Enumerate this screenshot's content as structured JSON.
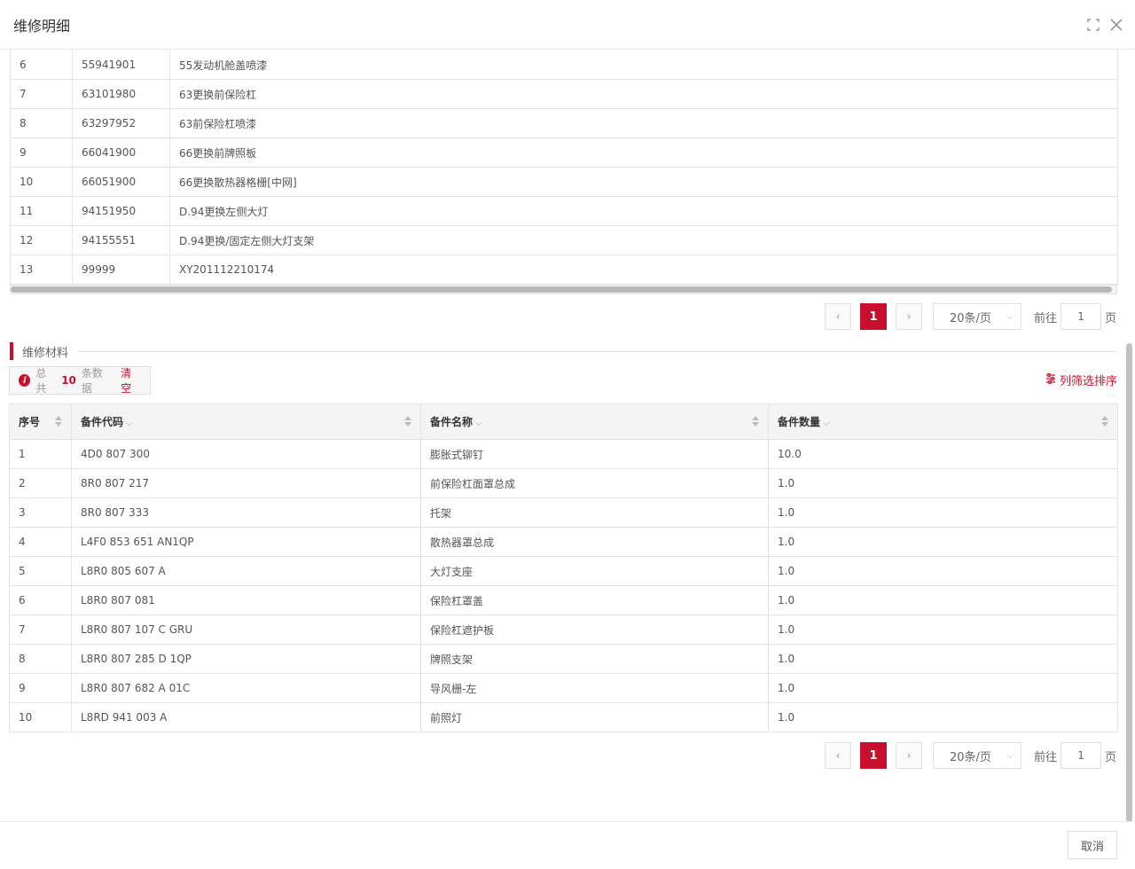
{
  "dialog": {
    "title": "维修明细"
  },
  "top_table": {
    "rows": [
      [
        "6",
        "55941901",
        "55发动机舱盖喷漆"
      ],
      [
        "7",
        "63101980",
        "63更换前保险杠"
      ],
      [
        "8",
        "63297952",
        "63前保险杠喷漆"
      ],
      [
        "9",
        "66041900",
        "66更换前牌照板"
      ],
      [
        "10",
        "66051900",
        "66更换散热器格栅[中网]"
      ],
      [
        "11",
        "94151950",
        "D.94更换左侧大灯"
      ],
      [
        "12",
        "94155551",
        "D.94更换/固定左侧大灯支架"
      ],
      [
        "13",
        "99999",
        "XY201112210174"
      ]
    ]
  },
  "pager_top": {
    "current": "1",
    "size": "20条/页",
    "goto": "前往",
    "page_input": "1",
    "page_unit": "页"
  },
  "materials": {
    "section_title": "维修材料",
    "info_prefix": "总共",
    "info_count": "10",
    "info_suffix": "条数据",
    "clear": "清空",
    "col_filter": "列筛选排序",
    "headers": [
      "序号",
      "备件代码",
      "备件名称",
      "备件数量"
    ],
    "rows": [
      [
        "1",
        "4D0 807 300",
        "膨胀式铆钉",
        "10.0"
      ],
      [
        "2",
        "8R0 807 217",
        "前保险杠面罩总成",
        "1.0"
      ],
      [
        "3",
        "8R0 807 333",
        "托架",
        "1.0"
      ],
      [
        "4",
        "L4F0 853 651 AN1QP",
        "散热器罩总成",
        "1.0"
      ],
      [
        "5",
        "L8R0 805 607 A",
        "大灯支座",
        "1.0"
      ],
      [
        "6",
        "L8R0 807 081",
        "保险杠罩盖",
        "1.0"
      ],
      [
        "7",
        "L8R0 807 107 C GRU",
        "保险杠遮护板",
        "1.0"
      ],
      [
        "8",
        "L8R0 807 285 D 1QP",
        "牌照支架",
        "1.0"
      ],
      [
        "9",
        "L8R0 807 682 A 01C",
        "导风栅-左",
        "1.0"
      ],
      [
        "10",
        "L8RD 941 003 A",
        "前照灯",
        "1.0"
      ]
    ]
  },
  "pager_bottom": {
    "current": "1",
    "size": "20条/页",
    "goto": "前往",
    "page_input": "1",
    "page_unit": "页"
  },
  "footer": {
    "cancel": "取消"
  },
  "colors": {
    "accent": "#c8102e"
  }
}
